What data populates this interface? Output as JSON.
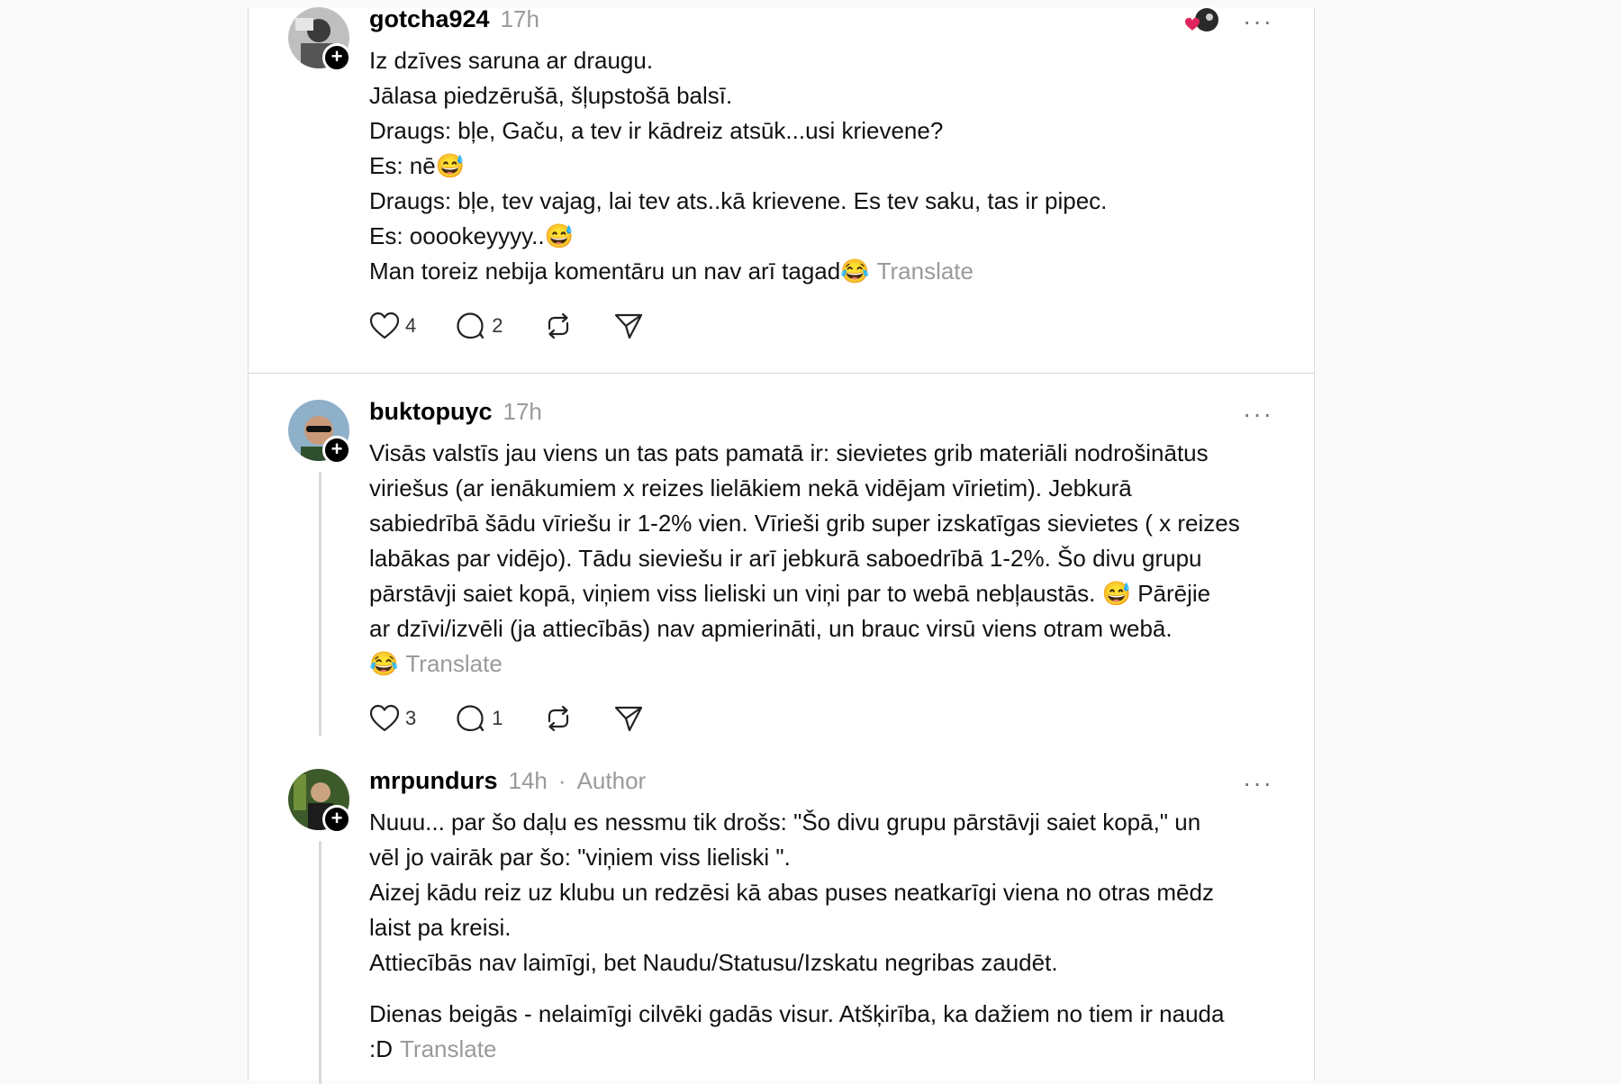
{
  "posts": [
    {
      "username": "gotcha924",
      "time": "17h",
      "lines": [
        "Iz dzīves saruna ar draugu.",
        "Jālasa piedzērušā, šļupstošā balsī.",
        "Draugs: bļe, Gaču, a tev ir kādreiz atsūk...usi krievene?",
        "Es: nē😅",
        "Draugs: bļe, tev vajag, lai tev ats..kā krievene. Es tev saku, tas ir pipec.",
        "Es: ooookeyyyy..😅",
        "Man toreiz nebija komentāru un nav arī tagad😂"
      ],
      "translate": "Translate",
      "likes": "4",
      "replies": "2"
    },
    {
      "username": "buktopuyc",
      "time": "17h",
      "lines": [
        "Visās valstīs jau viens un tas pats pamatā ir: sievietes grib materiāli nodrošinātus",
        "viriešus (ar ienākumiem x reizes lielākiem nekā vidējam vīrietim). Jebkurā",
        "sabiedrībā šādu vīriešu ir 1-2% vien. Vīrieši grib super izskatīgas sievietes ( x reizes",
        "labākas par vidējo). Tādu sieviešu ir arī jebkurā saboedrībā 1-2%. Šo divu grupu",
        "pārstāvji saiet kopā, viņiem viss lieliski un viņi par to webā nebļaustās. 😅 Pārējie",
        "ar dzīvi/izvēli (ja attiecībās) nav apmierināti, un brauc virsū viens otram webā.",
        "😂"
      ],
      "translate": "Translate",
      "likes": "3",
      "replies": "1"
    },
    {
      "username": "mrpundurs",
      "time": "14h",
      "separator": "·",
      "author_tag": "Author",
      "lines": [
        "Nuuu... par šo daļu es nessmu tik drošs: \"Šo divu grupu pārstāvji saiet kopā,\" un",
        "vēl jo vairāk par šo: \"viņiem viss lieliski \".",
        "Aizej kādu reiz uz klubu un redzēsi kā abas puses neatkarīgi viena no otras mēdz",
        "laist pa kreisi.",
        "Attiecībās nav laimīgi, bet Naudu/Statusu/Izskatu negribas zaudēt."
      ],
      "lines2": [
        "Dienas beigās - nelaimīgi cilvēki gadās visur. Atšķirība, ka dažiem no tiem ir nauda",
        ":D"
      ],
      "translate": "Translate"
    }
  ],
  "more_label": "···",
  "follow_symbol": "+",
  "colors": {
    "heart": "#e0245e",
    "muted": "#9a9a9a",
    "line": "#d9d9d9"
  },
  "icons": [
    "like-icon",
    "comment-icon",
    "repost-icon",
    "share-icon",
    "more-icon",
    "follow-plus-icon"
  ]
}
